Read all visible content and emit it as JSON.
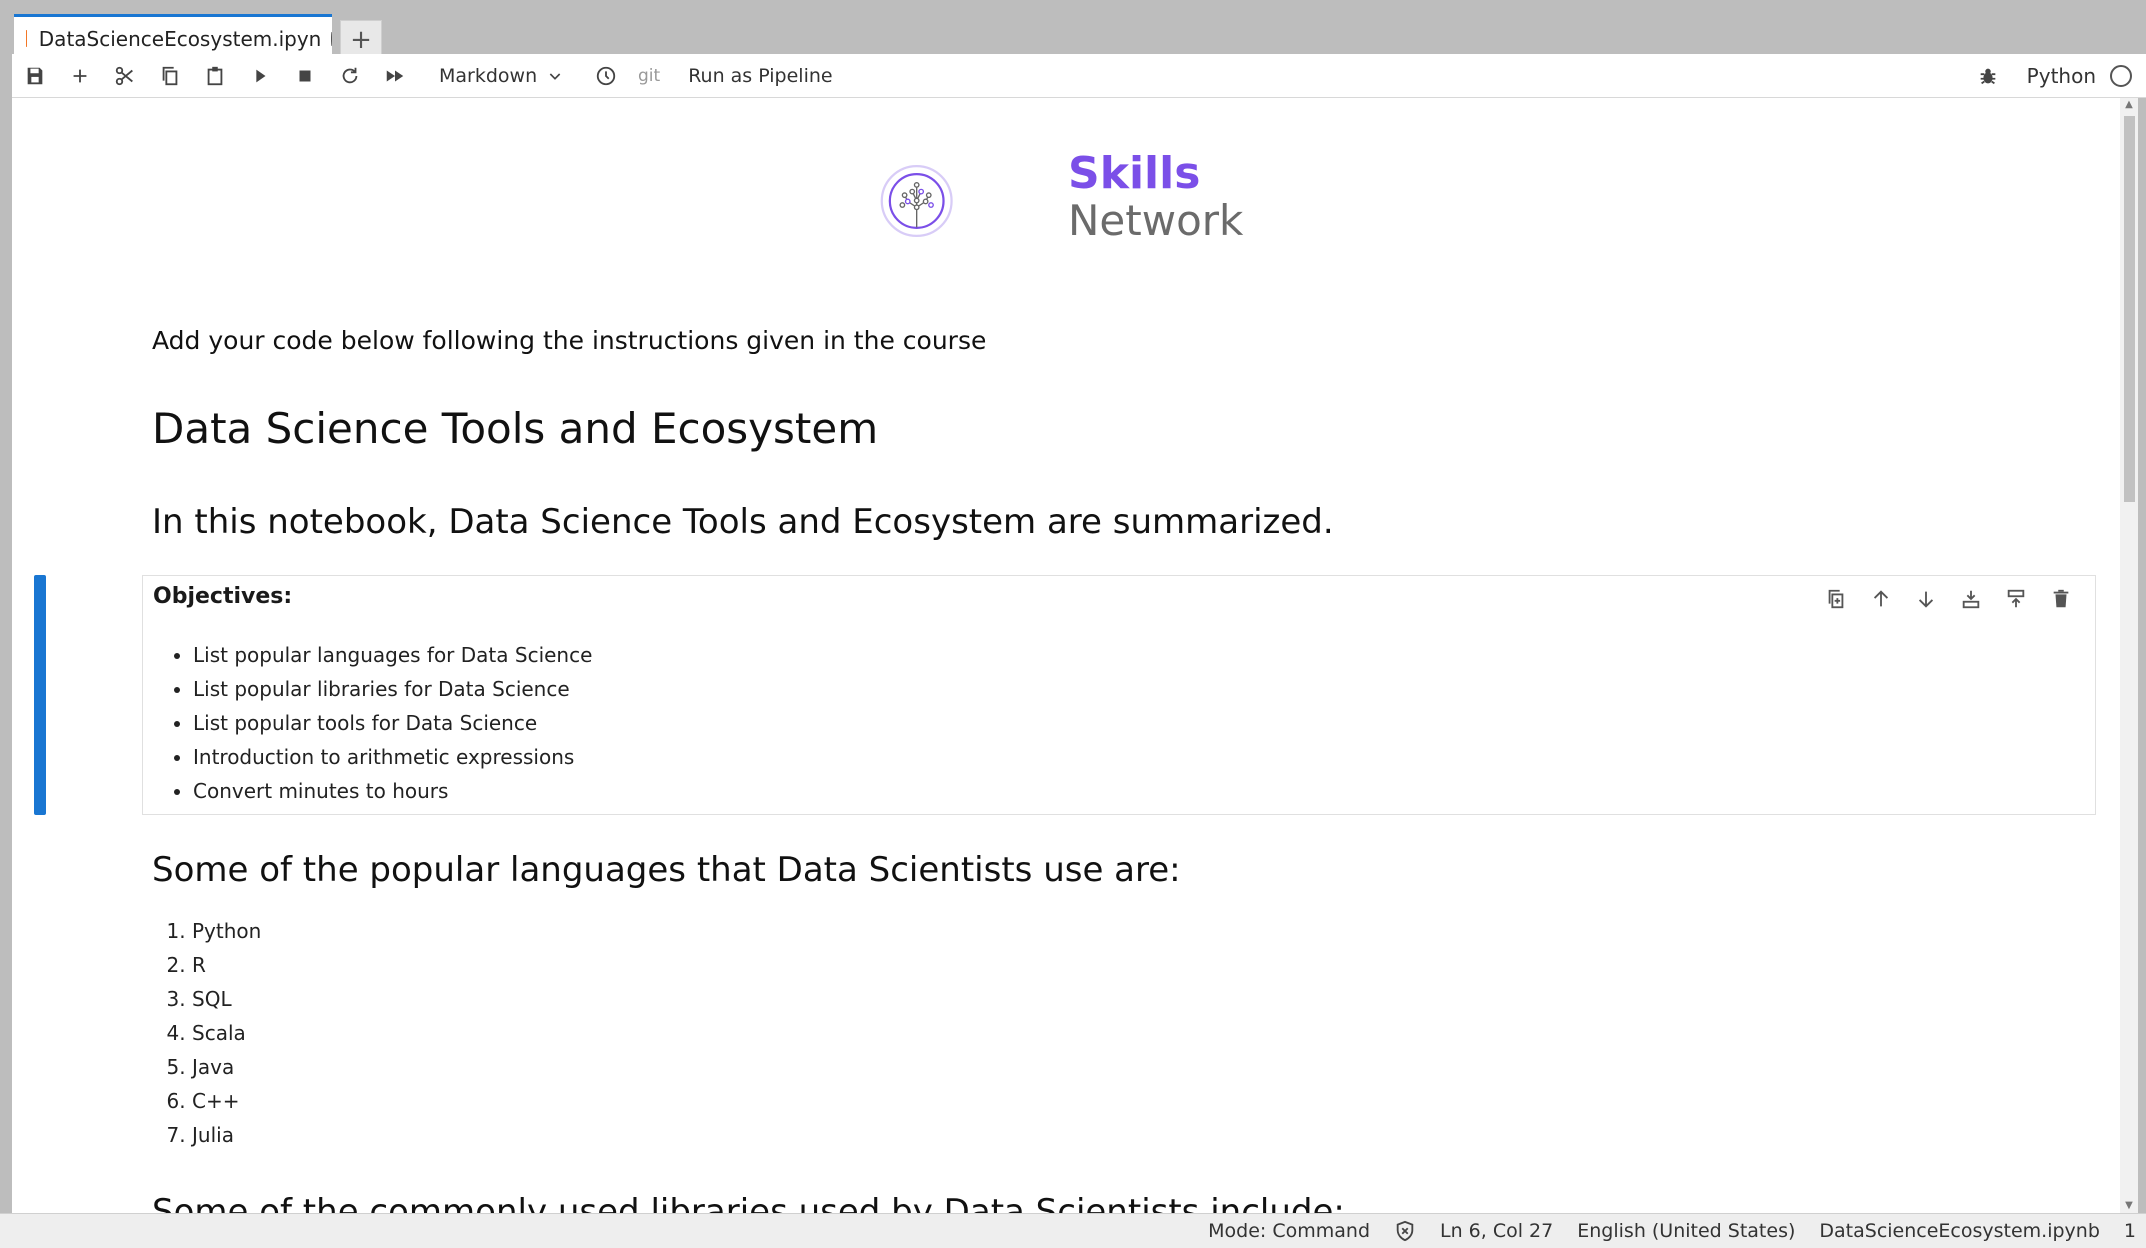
{
  "tab": {
    "filename": "DataScienceEcosystem.ipyn",
    "new_tab": "+"
  },
  "toolbar": {
    "icons": [
      "save-icon",
      "add-cell-icon",
      "cut-icon",
      "copy-icon",
      "paste-icon",
      "run-icon",
      "stop-icon",
      "restart-icon",
      "fast-forward-icon",
      "clock-icon"
    ],
    "cell_type": "Markdown",
    "git_label": "git",
    "pipeline_label": "Run as Pipeline",
    "kernel_name": "Python"
  },
  "logo": {
    "line1": "Skills",
    "line2": "Network",
    "brand_color": "#7B4FE8"
  },
  "notebook": {
    "intro": "Add your code below following the instructions given in the course",
    "title": "Data Science Tools and Ecosystem",
    "summary_heading": "In this notebook, Data Science Tools and Ecosystem are summarized.",
    "objectives": {
      "title": "Objectives:",
      "items": [
        "List popular languages for Data Science",
        "List popular libraries for Data Science",
        "List popular tools for Data Science",
        "Introduction to arithmetic expressions",
        "Convert minutes to hours"
      ]
    },
    "languages_heading": "Some of the popular languages that Data Scientists use are:",
    "languages": [
      "Python",
      "R",
      "SQL",
      "Scala",
      "Java",
      "C++",
      "Julia"
    ],
    "cutoff_heading": "Some of the commonly used libraries used by Data Scientists include:"
  },
  "status": {
    "mode": "Mode: Command",
    "position": "Ln 6, Col 27",
    "language": "English (United States)",
    "file": "DataScienceEcosystem.ipynb",
    "extra": "1"
  }
}
